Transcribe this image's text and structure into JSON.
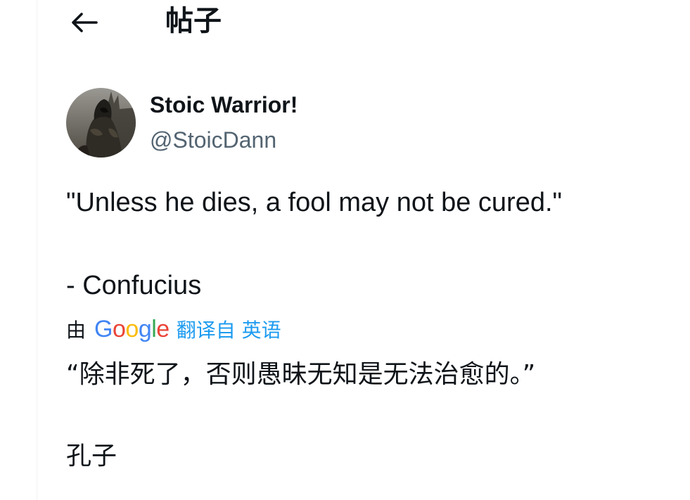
{
  "header": {
    "back_icon": "arrow-left-icon",
    "title": "帖子"
  },
  "author": {
    "display_name": "Stoic Warrior!",
    "handle": "@StoicDann",
    "avatar_icon": "avatar-armored-warrior"
  },
  "tweet": {
    "text_line_1": "\"Unless he dies, a fool may not be cured.\"",
    "text_line_2": "- Confucius"
  },
  "translation": {
    "by_label": "由",
    "provider_logo": "Google",
    "link_text": "翻译自 英语",
    "translated_line_1": "“除非死了，否则愚昧无知是无法治愈的。”",
    "translated_line_2": "孔子"
  },
  "colors": {
    "text_primary": "#0f1419",
    "text_secondary": "#536471",
    "link_blue": "#1d9bf0",
    "google_blue": "#4285F4",
    "google_red": "#EA4335",
    "google_yellow": "#FBBC05",
    "google_green": "#34A853"
  }
}
